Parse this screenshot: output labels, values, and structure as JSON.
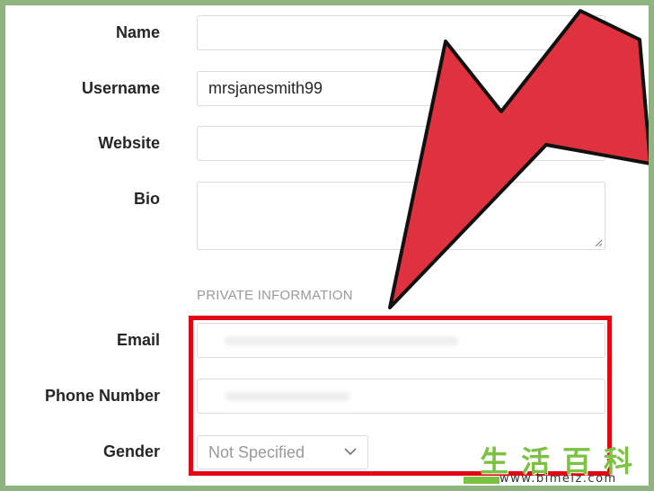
{
  "form": {
    "name": {
      "label": "Name",
      "value": ""
    },
    "username": {
      "label": "Username",
      "value": "mrsjanesmith99"
    },
    "website": {
      "label": "Website",
      "value": ""
    },
    "bio": {
      "label": "Bio",
      "value": ""
    },
    "private_section_title": "PRIVATE INFORMATION",
    "email": {
      "label": "Email",
      "value": ""
    },
    "phone": {
      "label": "Phone Number",
      "value": ""
    },
    "gender": {
      "label": "Gender",
      "selected": "Not Specified"
    }
  },
  "annotation": {
    "arrow_color": "#e0323e",
    "highlight_color": "#e30613"
  },
  "watermark": {
    "chars": "生活百科",
    "url": "www.bimeiz.com",
    "color": "#7cc242"
  }
}
